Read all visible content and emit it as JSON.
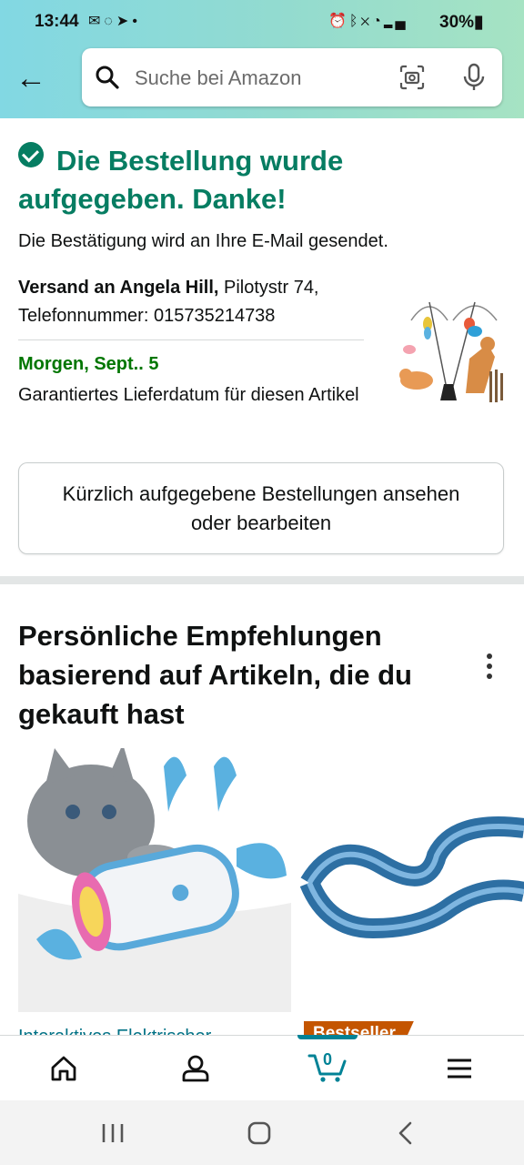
{
  "status_bar": {
    "time": "13:44",
    "battery": "30%",
    "left_icons": [
      "message-icon",
      "ebay-icon",
      "telegram-icon",
      "dot-icon"
    ],
    "right_icons": [
      "alarm-icon",
      "bluetooth-icon",
      "mute-icon",
      "wifi-icon",
      "signal-icon",
      "battery-icon"
    ]
  },
  "search": {
    "placeholder": "Suche bei Amazon"
  },
  "confirmation": {
    "title": "Die Bestellung wurde aufgegeben. Danke!",
    "email_note": "Die Bestätigung wird an Ihre E-Mail gesendet.",
    "shipping_label": "Versand an Angela Hill,",
    "shipping_address": " Pilotystr 74, Telefonnummer: 015735214738",
    "delivery_date": "Morgen, Sept.. 5",
    "delivery_note": "Garantiertes Lieferdatum für diesen Artikel",
    "orders_button": "Kürzlich aufgegebene Bestellungen ansehen oder bearbeiten"
  },
  "recommendations": {
    "title": "Persönliche Empfehlungen basierend auf Artikeln, die du gekauft hast",
    "first_product_link": "Interaktives Elektrischer",
    "badge": "Bestseller"
  },
  "bottom_nav": {
    "items": [
      "home-icon",
      "account-icon",
      "cart-icon",
      "menu-icon"
    ],
    "cart_count": "0"
  },
  "colors": {
    "success_green": "#067d62",
    "date_green": "#007600",
    "link_teal": "#007185",
    "cart_teal": "#008296",
    "badge_orange": "#c45500"
  }
}
